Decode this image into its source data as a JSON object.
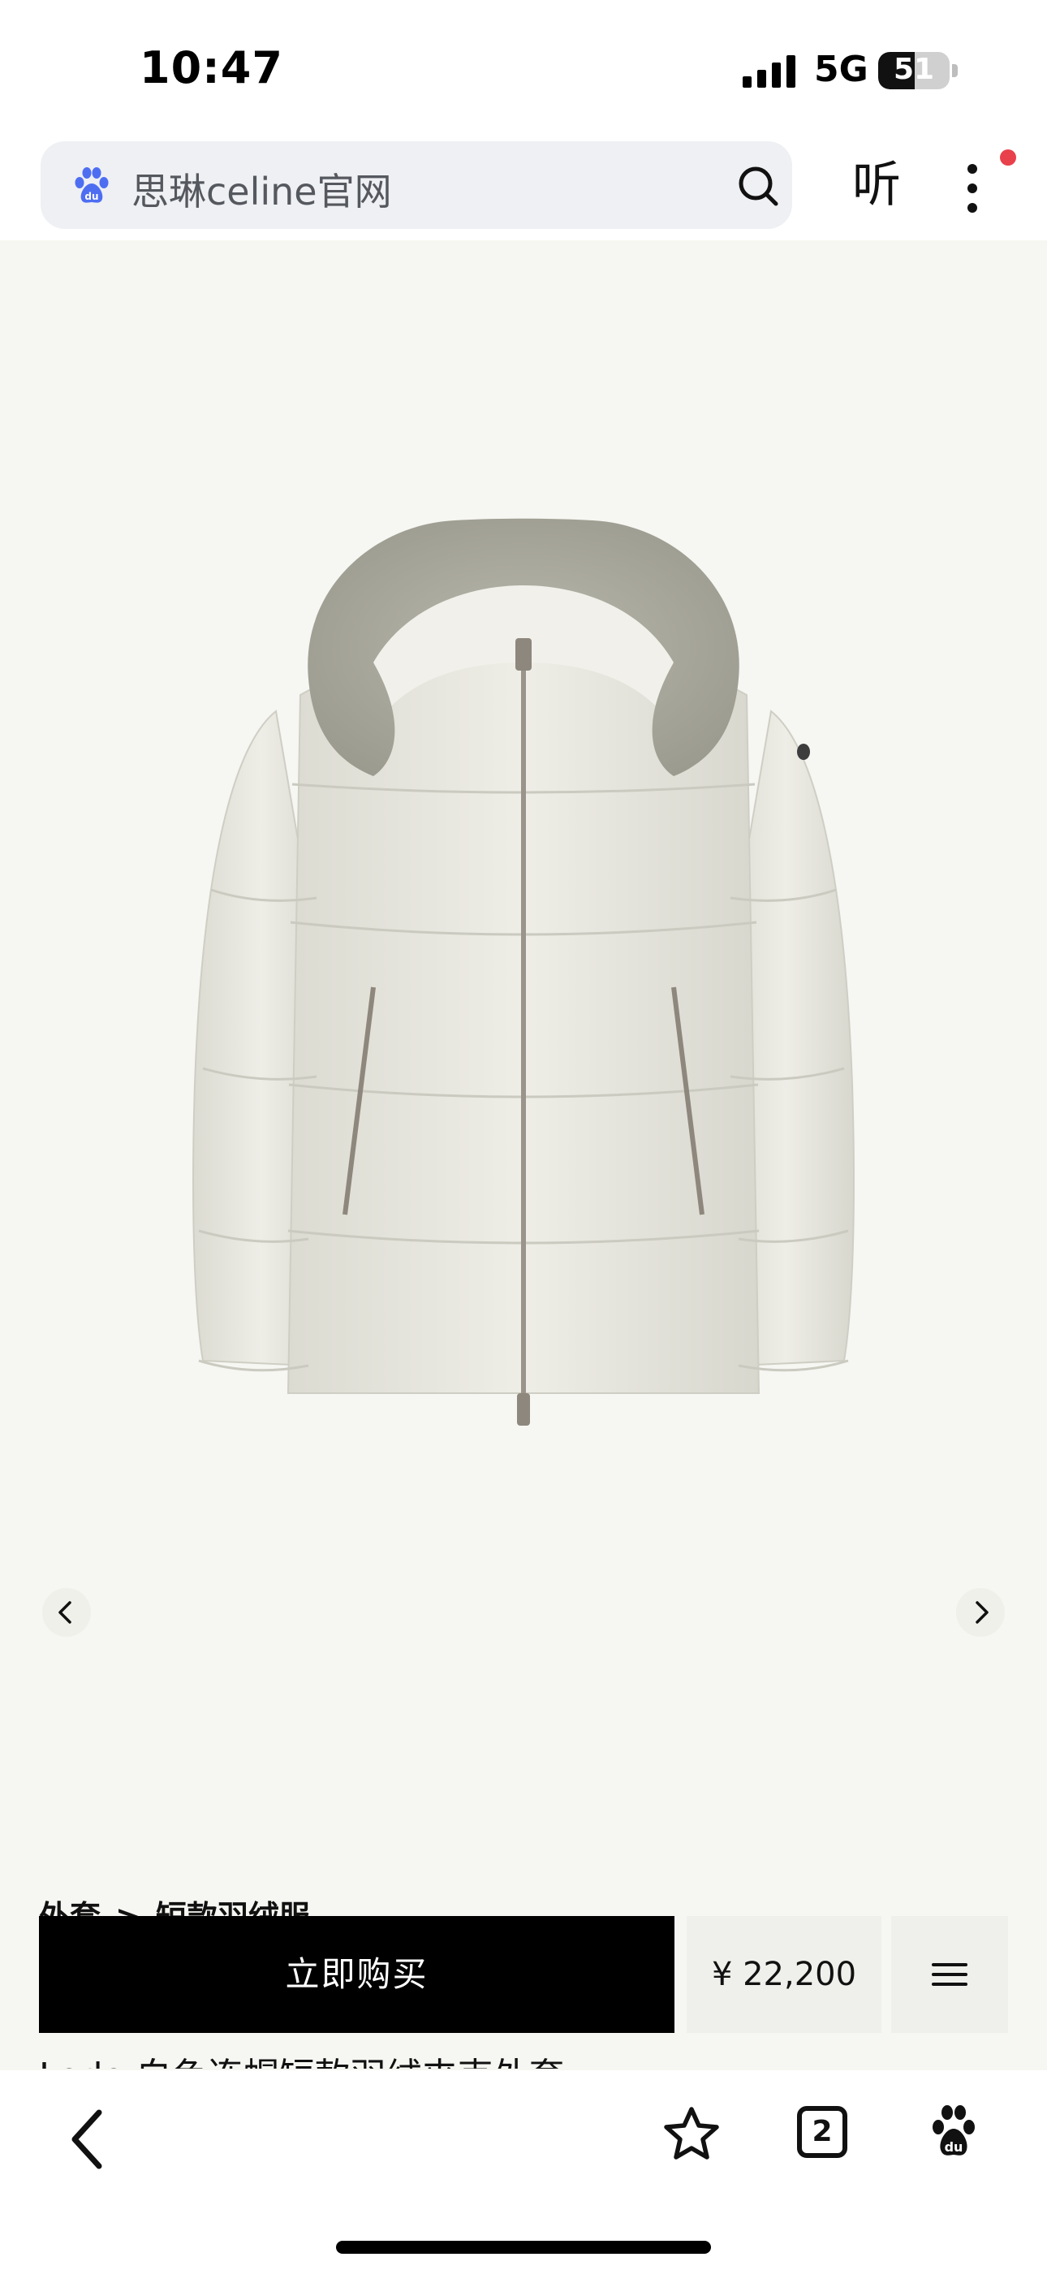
{
  "status_bar": {
    "time": "10:47",
    "network": "5G",
    "battery_percent": "51",
    "battery_level": 0.51,
    "signal_icon": "signal-bars-icon",
    "battery_icon": "battery-icon"
  },
  "search_bar": {
    "query": "思琳celine官网",
    "logo_icon": "baidu-paw-icon",
    "search_icon": "search-icon"
  },
  "top_actions": {
    "listen_label": "听",
    "more_icon": "vertical-dots-icon",
    "notification_color": "#e8414b"
  },
  "product": {
    "image_icon": "puffer-jacket-image",
    "background_color": "#f6f6f2",
    "breadcrumb": [
      "外套",
      ">",
      "短款羽绒服"
    ],
    "title": "Lodo 白色连帽短款羽绒夹克外套",
    "prev_icon": "chevron-left-icon",
    "next_icon": "chevron-right-icon"
  },
  "purchase": {
    "buy_now_label": "立即购买",
    "price": "¥ 22,200",
    "menu_icon": "hamburger-menu-icon"
  },
  "bottom_toolbar": {
    "back_icon": "chevron-left-icon",
    "favorite_icon": "star-icon",
    "tab_count": "2",
    "home_icon": "baidu-paw-icon"
  }
}
